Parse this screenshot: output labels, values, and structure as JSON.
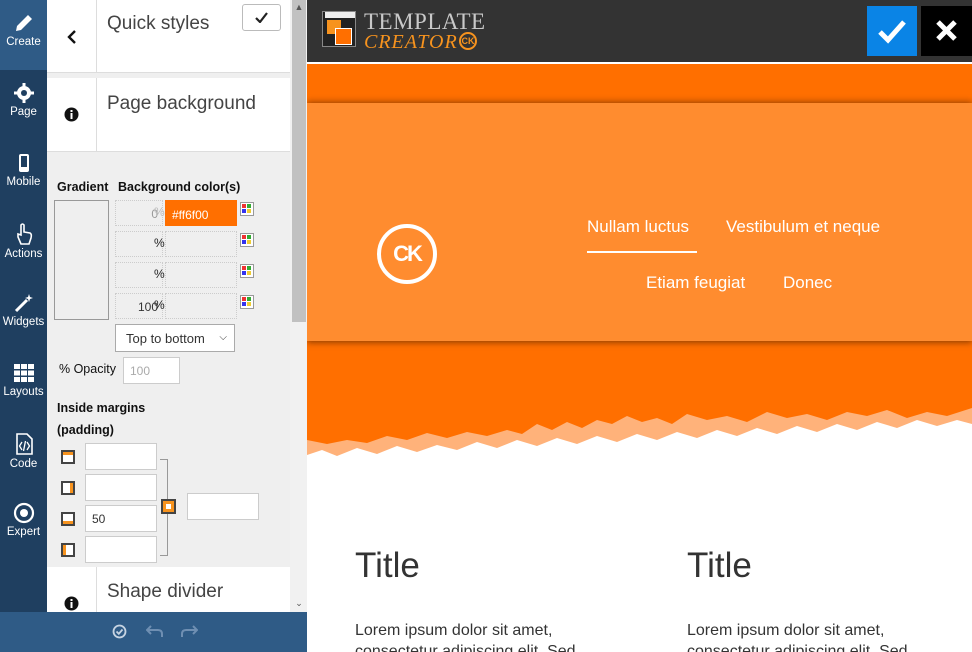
{
  "rail": [
    {
      "label": "Create",
      "icon": "pencil-icon"
    },
    {
      "label": "Page",
      "icon": "gear-icon"
    },
    {
      "label": "Mobile",
      "icon": "mobile-icon"
    },
    {
      "label": "Actions",
      "icon": "hand-pointer-icon"
    },
    {
      "label": "Widgets",
      "icon": "magic-wand-icon"
    },
    {
      "label": "Layouts",
      "icon": "grid-icon"
    },
    {
      "label": "Code",
      "icon": "code-file-icon"
    },
    {
      "label": "Expert",
      "icon": "target-icon"
    }
  ],
  "panel": {
    "quick_styles": "Quick styles",
    "page_background": "Page background",
    "shape_divider": "Shape divider",
    "gradient_label": "Gradient",
    "bg_colors_label": "Background color(s)",
    "stops": [
      {
        "percent": "0",
        "color": "#ff6f00"
      },
      {
        "percent": "",
        "color": ""
      },
      {
        "percent": "",
        "color": ""
      },
      {
        "percent": "100",
        "color": ""
      }
    ],
    "percent_sign": "%",
    "direction": "Top to bottom",
    "opacity_label": "% Opacity",
    "opacity_placeholder": "100",
    "inside_margins": "Inside margins",
    "padding": "(padding)",
    "margins": [
      "",
      "",
      "50",
      ""
    ],
    "margin_all": ""
  },
  "preview": {
    "logo_top": "TEMPLATE",
    "logo_bottom": "CREATOR",
    "logo_small": "Creator",
    "logo_badge": "CK",
    "site_logo": "CK",
    "nav": [
      "Nullam luctus",
      "Vestibulum et neque",
      "Etiam feugiat",
      "Donec"
    ],
    "columns": [
      {
        "title": "Title",
        "text": "Lorem ipsum dolor sit amet, consectetur adipiscing elit. Sed"
      },
      {
        "title": "Title",
        "text": "Lorem ipsum dolor sit amet, consectetur adipiscing elit. Sed"
      }
    ]
  },
  "colors": {
    "accent": "#ff6f00",
    "header": "#ff8c2f",
    "save": "#0a84e6",
    "rail": "#1f3f60"
  }
}
